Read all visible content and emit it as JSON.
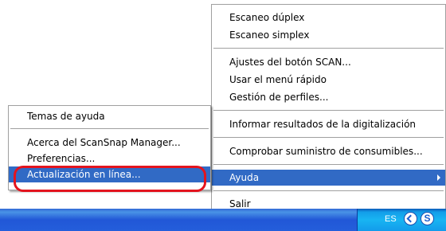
{
  "main_menu": {
    "items": [
      {
        "label": "Escaneo dúplex"
      },
      {
        "label": "Escaneo simplex"
      },
      {
        "label": "Ajustes del botón SCAN..."
      },
      {
        "label": "Usar el menú rápido"
      },
      {
        "label": "Gestión de perfiles..."
      },
      {
        "label": "Informar resultados de la digitalización"
      },
      {
        "label": "Comprobar suministro de consumibles..."
      },
      {
        "label": "Ayuda"
      },
      {
        "label": "Salir"
      }
    ]
  },
  "help_submenu": {
    "items": [
      {
        "label": "Temas de ayuda"
      },
      {
        "label": "Acerca del ScanSnap Manager..."
      },
      {
        "label": "Preferencias..."
      },
      {
        "label": "Actualización en línea..."
      }
    ]
  },
  "taskbar": {
    "language": "ES",
    "tray_icons": [
      "back-icon",
      "scansnap-icon"
    ],
    "scansnap_glyph": "S"
  },
  "colors": {
    "highlight": "#316ac5",
    "annotation_ring": "#e3141e",
    "taskbar": "#245edb"
  }
}
